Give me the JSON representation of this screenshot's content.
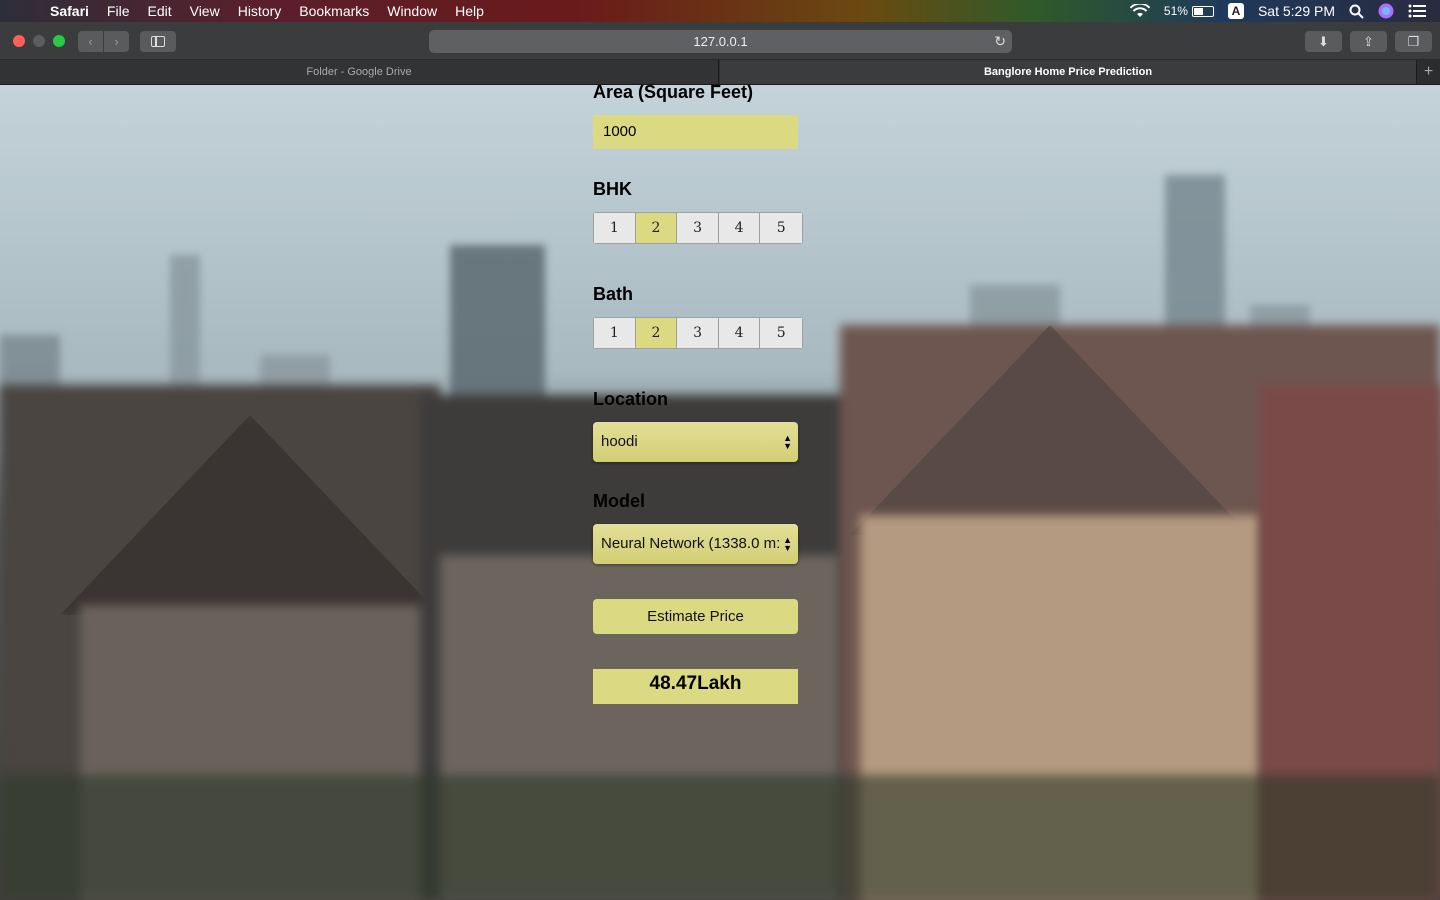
{
  "menubar": {
    "app": "Safari",
    "items": [
      "File",
      "Edit",
      "View",
      "History",
      "Bookmarks",
      "Window",
      "Help"
    ],
    "battery": "51%",
    "input_source": "A",
    "clock": "Sat 5:29 PM"
  },
  "browser": {
    "url": "127.0.0.1",
    "tabs": [
      {
        "title": "Folder - Google Drive",
        "active": false
      },
      {
        "title": "Banglore Home Price Prediction",
        "active": true
      }
    ]
  },
  "form": {
    "area_label": "Area (Square Feet)",
    "area_value": "1000",
    "bhk_label": "BHK",
    "bhk_options": [
      "1",
      "2",
      "3",
      "4",
      "5"
    ],
    "bhk_selected": "2",
    "bath_label": "Bath",
    "bath_options": [
      "1",
      "2",
      "3",
      "4",
      "5"
    ],
    "bath_selected": "2",
    "location_label": "Location",
    "location_value": "hoodi",
    "model_label": "Model",
    "model_value": "Neural Network (1338.0 m:",
    "estimate_button": "Estimate Price",
    "result": "48.47Lakh"
  },
  "colors": {
    "accent_yellow": "#dcd983"
  }
}
